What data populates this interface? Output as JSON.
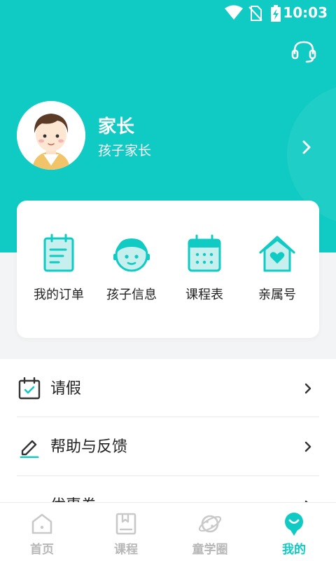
{
  "status_bar": {
    "time": "10:03"
  },
  "colors": {
    "brand": "#10cbc4",
    "icon_fill": "#c6efed",
    "text": "#222222",
    "inactive": "#b7b7b7"
  },
  "header": {
    "support_icon": "headset-icon"
  },
  "profile": {
    "name": "家长",
    "role": "孩子家长"
  },
  "shortcuts": [
    {
      "label": "我的订单",
      "icon": "order-icon"
    },
    {
      "label": "孩子信息",
      "icon": "child-icon"
    },
    {
      "label": "课程表",
      "icon": "calendar-icon"
    },
    {
      "label": "亲属号",
      "icon": "home-heart-icon"
    }
  ],
  "menu": [
    {
      "label": "请假",
      "icon": "calendar-check-icon"
    },
    {
      "label": "帮助与反馈",
      "icon": "edit-icon"
    },
    {
      "label": "优惠券",
      "icon": "coupon-icon"
    }
  ],
  "tabs": [
    {
      "label": "首页",
      "icon": "home-icon",
      "active": false
    },
    {
      "label": "课程",
      "icon": "book-icon",
      "active": false
    },
    {
      "label": "童学圈",
      "icon": "planet-icon",
      "active": false
    },
    {
      "label": "我的",
      "icon": "profile-icon",
      "active": true
    }
  ]
}
